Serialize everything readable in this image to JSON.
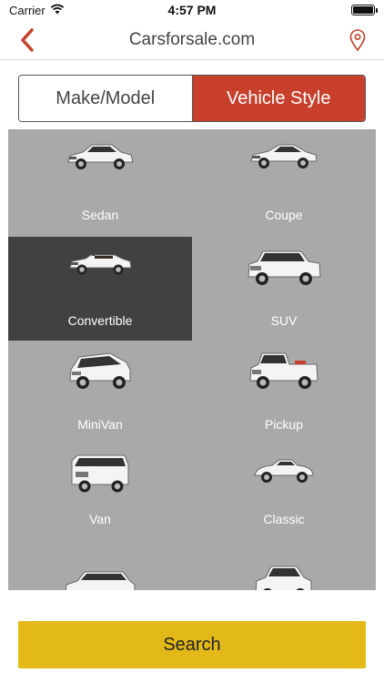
{
  "status_bar": {
    "carrier": "Carrier",
    "time": "4:57 PM",
    "wifi_icon": "wifi-icon",
    "battery_icon": "battery-icon"
  },
  "nav": {
    "title": "Carsforsale.com",
    "back_icon": "chevron-left-icon",
    "location_icon": "map-pin-icon",
    "accent_color": "#c8402b"
  },
  "segments": {
    "make_model": "Make/Model",
    "vehicle_style": "Vehicle Style",
    "active": "Vehicle Style"
  },
  "vehicle_styles": {
    "selected": "Convertible",
    "items": [
      {
        "label": "Sedan",
        "car_color": "#ffffff"
      },
      {
        "label": "Coupe",
        "car_color": "#ffffff"
      },
      {
        "label": "Convertible",
        "car_color": "#ffffff"
      },
      {
        "label": "SUV",
        "car_color": "#ffffff"
      },
      {
        "label": "MiniVan",
        "car_color": "#ffffff"
      },
      {
        "label": "Pickup",
        "car_color": "#ffffff"
      },
      {
        "label": "Van",
        "car_color": "#ffffff"
      },
      {
        "label": "Classic",
        "car_color": "#ffffff"
      },
      {
        "label": "",
        "car_color": "#ffffff"
      },
      {
        "label": "",
        "car_color": "#ffffff"
      }
    ]
  },
  "search": {
    "label": "Search",
    "color": "#e3b919"
  }
}
